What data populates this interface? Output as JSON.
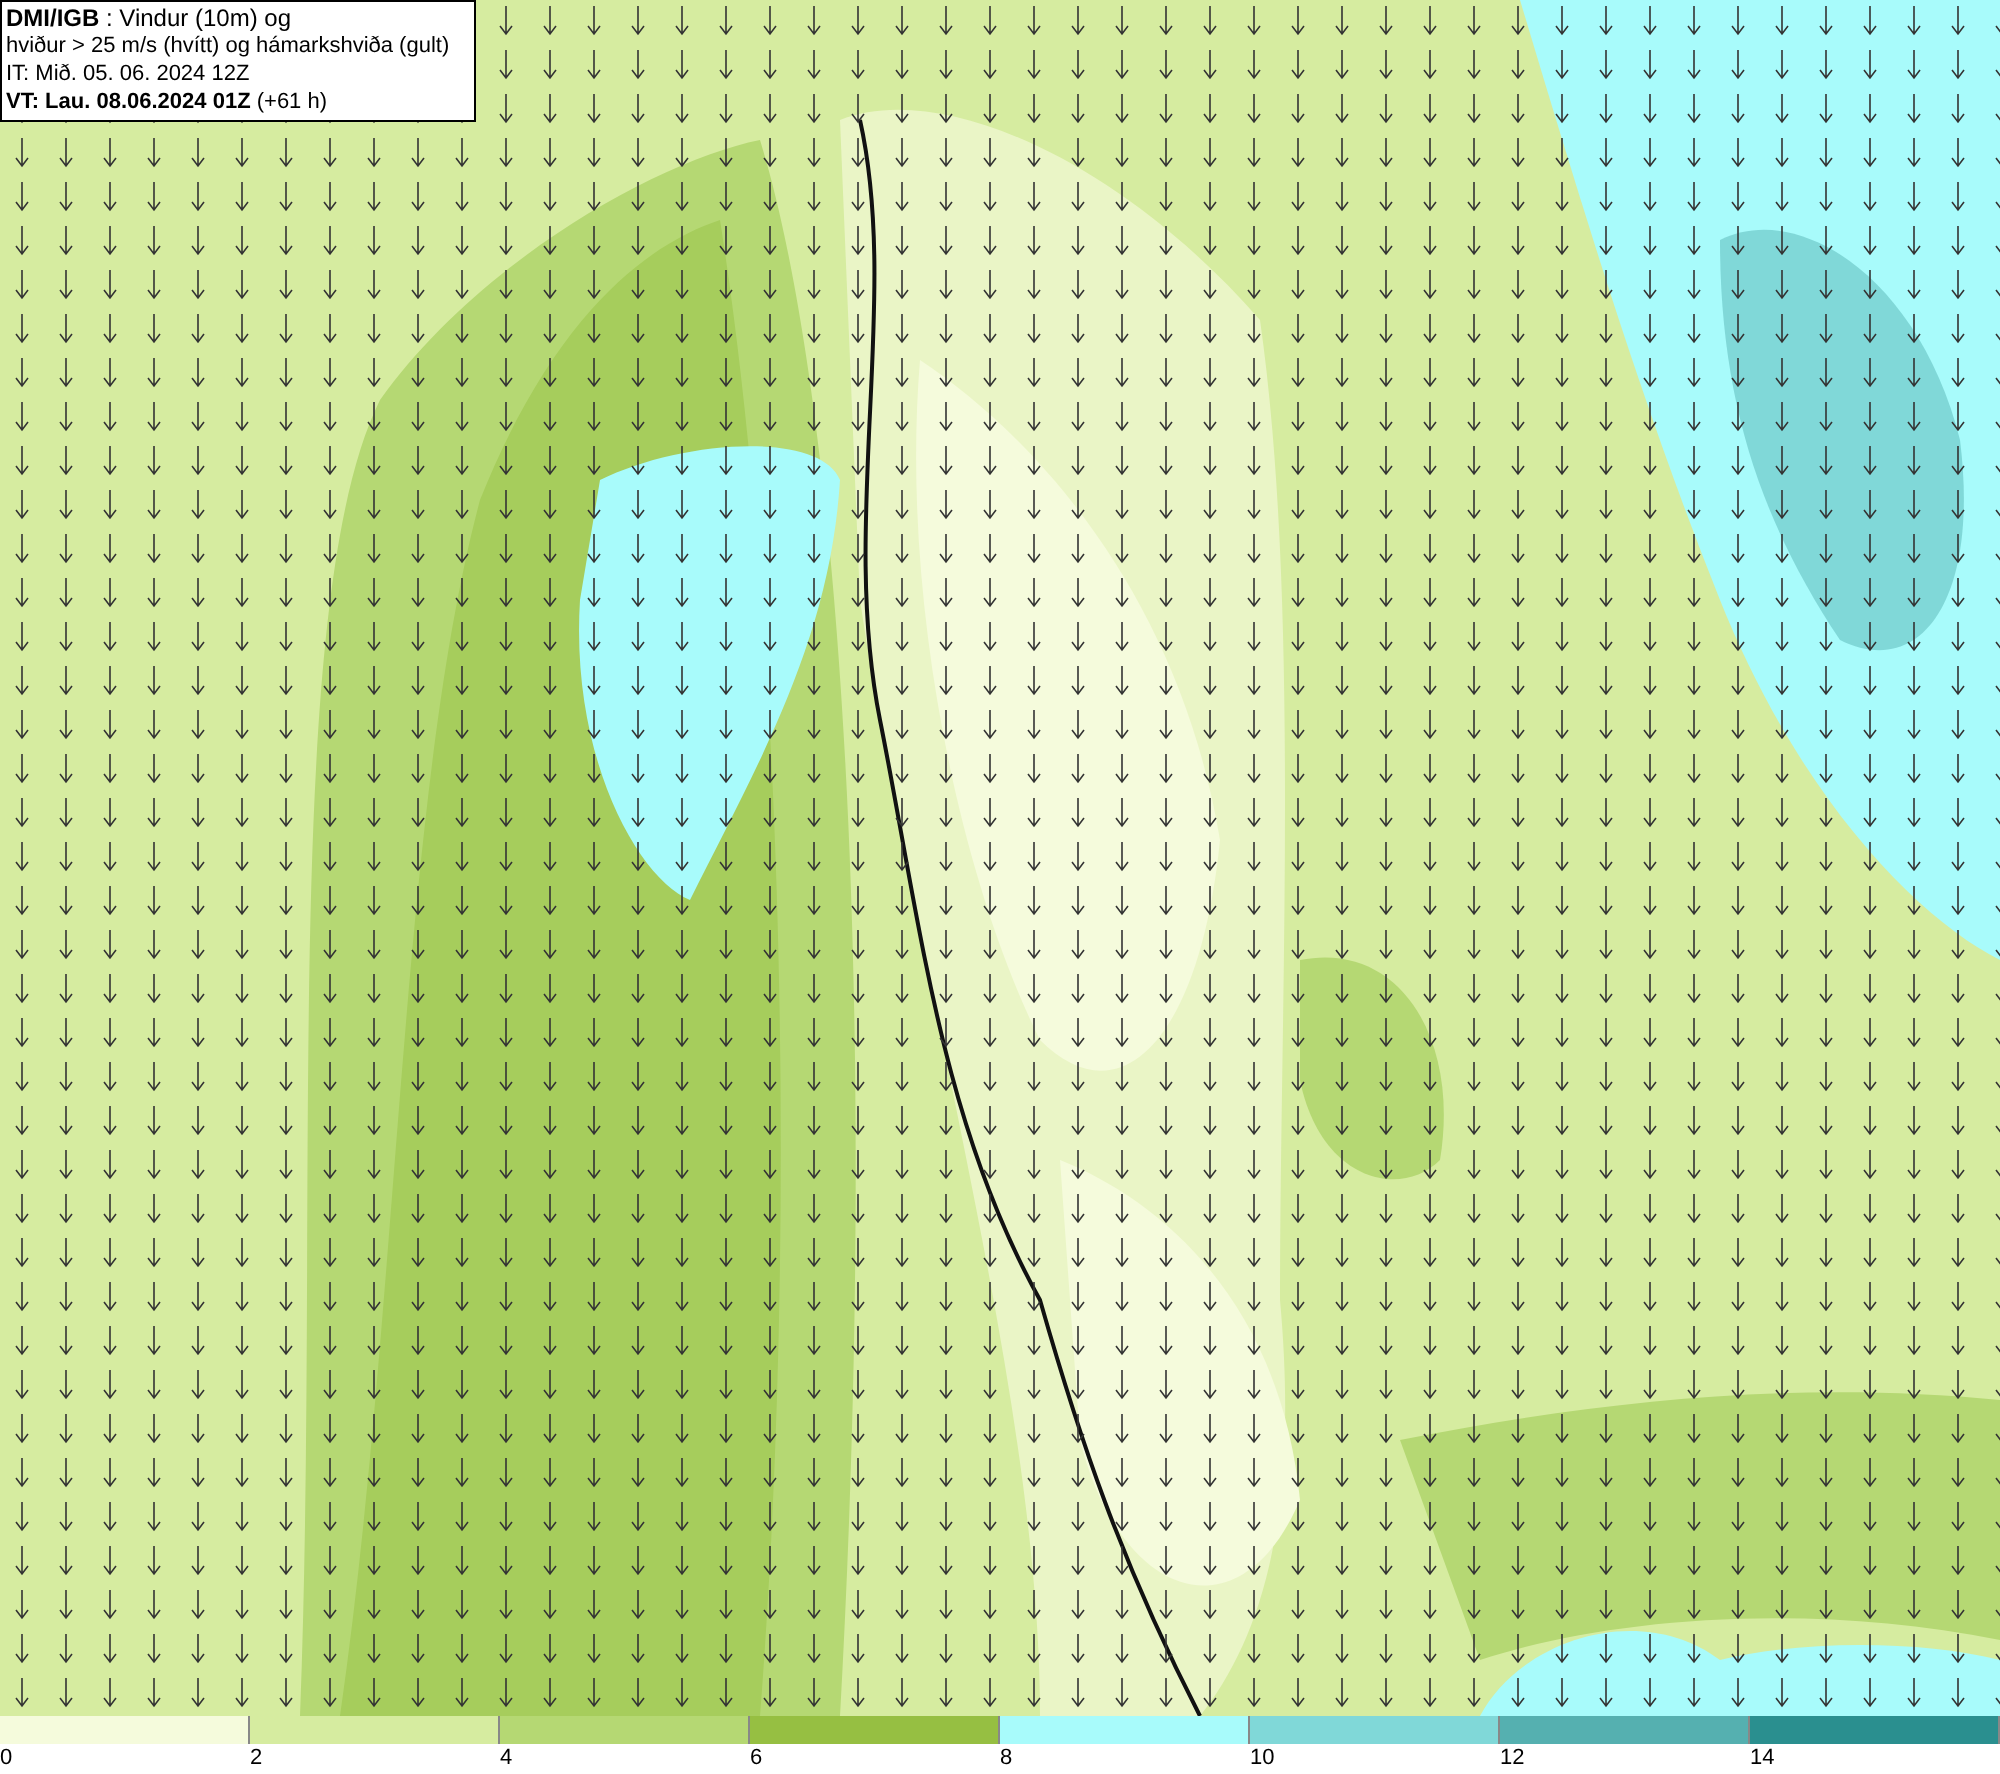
{
  "info_box": {
    "lines": [
      "**DMI/IGB** : Vindur (10m) og",
      "hviður > 25 m/s (hvítt) og hámarkshviða (gult)",
      "IT: Mið. 05. 06. 2024 12Z",
      "**VT: Lau. 08.06.2024 01Z** (+61 h)"
    ]
  },
  "legend": [
    {
      "color": "#f5fbdc",
      "label": "0"
    },
    {
      "color": "#d6eca0",
      "label": "2"
    },
    {
      "color": "#b5d873",
      "label": "4"
    },
    {
      "color": "#96bf42",
      "label": "6"
    },
    {
      "color": "#a8fbfb",
      "label": "8"
    },
    {
      "color": "#80d8d8",
      "label": "10"
    },
    {
      "color": "#55b0b0",
      "label": "12"
    },
    {
      "color": "#2a8f8f",
      "label": "14"
    }
  ]
}
